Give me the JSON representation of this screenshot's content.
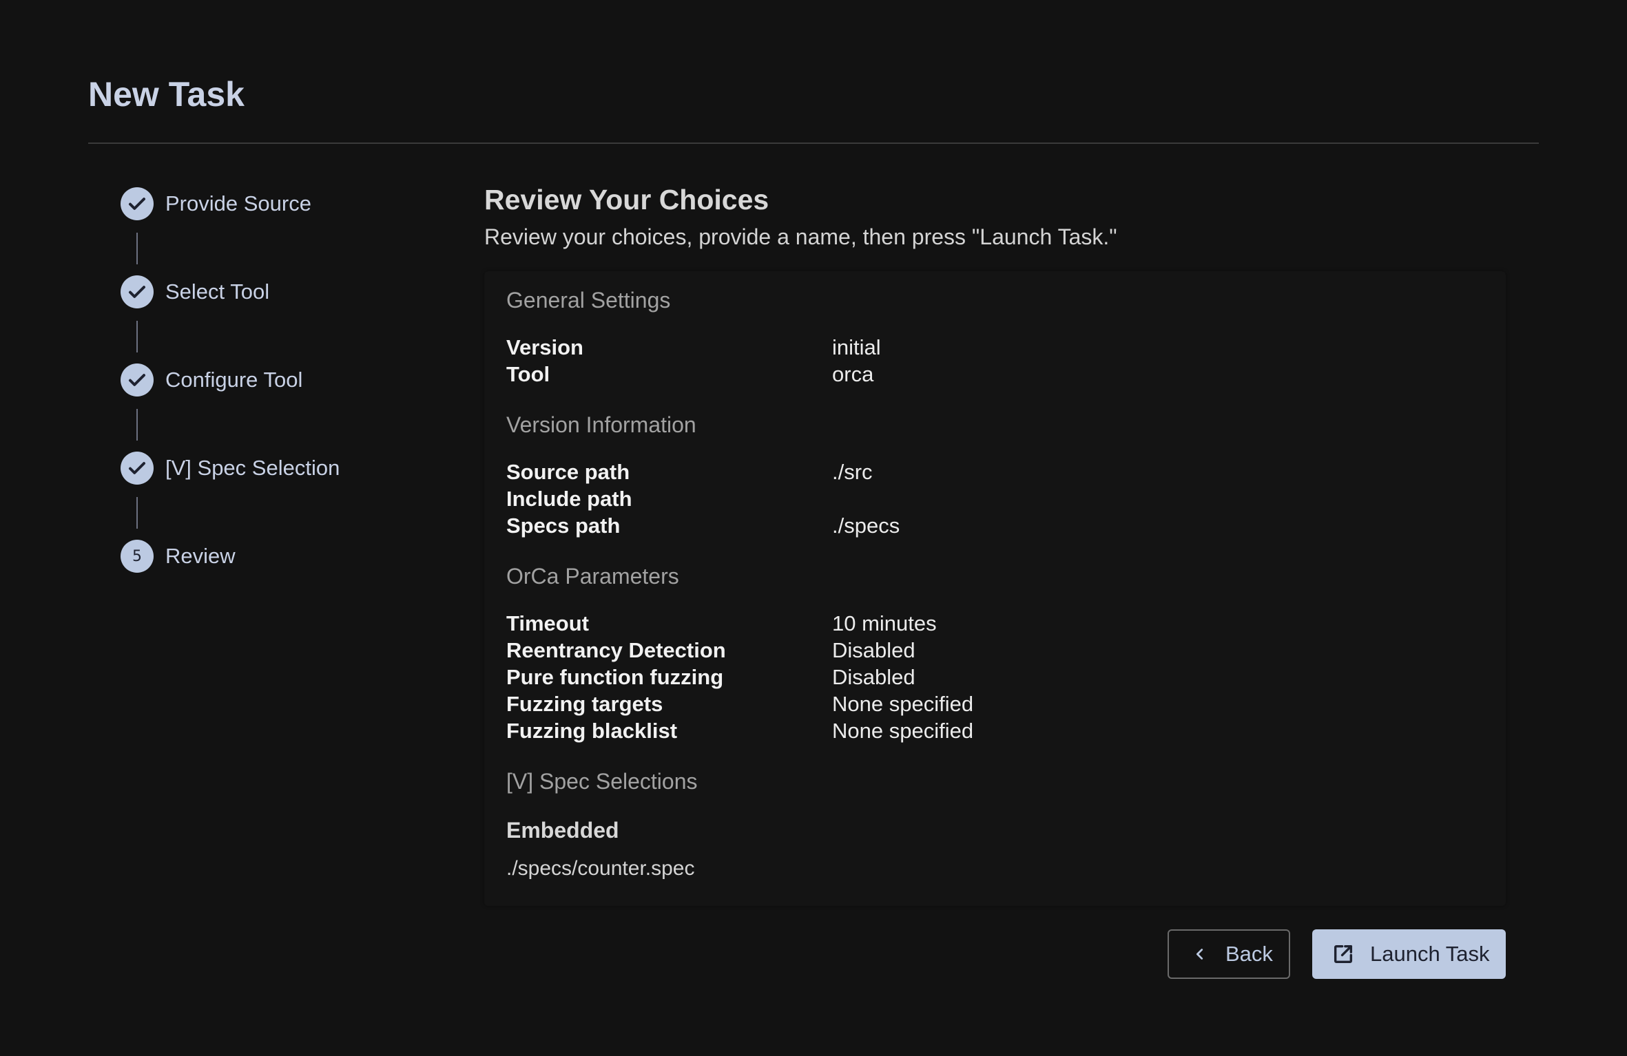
{
  "header": {
    "title": "New Task"
  },
  "stepper": {
    "steps": [
      {
        "label": "Provide Source",
        "state": "complete",
        "icon": "check-icon"
      },
      {
        "label": "Select Tool",
        "state": "complete",
        "icon": "check-icon"
      },
      {
        "label": "Configure Tool",
        "state": "complete",
        "icon": "check-icon"
      },
      {
        "label": "[V] Spec Selection",
        "state": "complete",
        "icon": "check-icon"
      },
      {
        "label": "Review",
        "state": "current",
        "number": "5"
      }
    ]
  },
  "main": {
    "title": "Review Your Choices",
    "subtitle": "Review your choices, provide a name, then press \"Launch Task.\""
  },
  "review": {
    "general": {
      "heading": "General Settings",
      "rows": [
        {
          "key": "Version",
          "value": "initial"
        },
        {
          "key": "Tool",
          "value": "orca"
        }
      ]
    },
    "version_info": {
      "heading": "Version Information",
      "rows": [
        {
          "key": "Source path",
          "value": "./src"
        },
        {
          "key": "Include path",
          "value": ""
        },
        {
          "key": "Specs path",
          "value": "./specs"
        }
      ]
    },
    "orca": {
      "heading": "OrCa Parameters",
      "rows": [
        {
          "key": "Timeout",
          "value": "10 minutes"
        },
        {
          "key": "Reentrancy Detection",
          "value": "Disabled"
        },
        {
          "key": "Pure function fuzzing",
          "value": "Disabled"
        },
        {
          "key": "Fuzzing targets",
          "value": "None specified"
        },
        {
          "key": "Fuzzing blacklist",
          "value": "None specified"
        }
      ]
    },
    "spec_selections": {
      "heading": "[V] Spec Selections",
      "embedded_heading": "Embedded",
      "files": [
        "./specs/counter.spec"
      ]
    }
  },
  "actions": {
    "back_label": "Back",
    "back_icon": "chevron-left-icon",
    "launch_label": "Launch Task",
    "launch_icon": "external-link-icon"
  },
  "colors": {
    "background": "#121212",
    "accent": "#bccae2",
    "title": "#c9d2e6"
  }
}
